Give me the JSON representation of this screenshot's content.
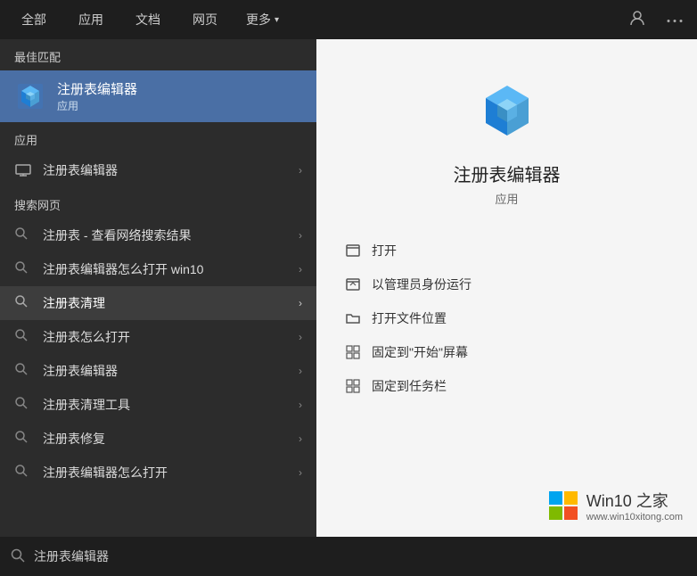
{
  "topBar": {
    "tabs": [
      {
        "label": "全部",
        "id": "all"
      },
      {
        "label": "应用",
        "id": "apps"
      },
      {
        "label": "文档",
        "id": "docs"
      },
      {
        "label": "网页",
        "id": "web"
      },
      {
        "label": "更多",
        "id": "more"
      }
    ],
    "icons": {
      "user": "👤",
      "dots": "···"
    }
  },
  "leftPanel": {
    "bestMatch": {
      "sectionLabel": "最佳匹配",
      "name": "注册表编辑器",
      "type": "应用"
    },
    "appSection": {
      "sectionLabel": "应用",
      "items": [
        {
          "text": "注册表编辑器",
          "hasArrow": true
        }
      ]
    },
    "webSection": {
      "sectionLabel": "搜索网页",
      "items": [
        {
          "text": "注册表 - 查看网络搜索结果",
          "hasArrow": true
        },
        {
          "text": "注册表编辑器怎么打开 win10",
          "hasArrow": true
        },
        {
          "text": "注册表清理",
          "hasArrow": true,
          "highlighted": true
        },
        {
          "text": "注册表怎么打开",
          "hasArrow": true
        },
        {
          "text": "注册表编辑器",
          "hasArrow": true
        },
        {
          "text": "注册表清理工具",
          "hasArrow": true
        },
        {
          "text": "注册表修复",
          "hasArrow": true
        },
        {
          "text": "注册表编辑器怎么打开",
          "hasArrow": true
        }
      ]
    }
  },
  "rightPanel": {
    "appName": "注册表编辑器",
    "appType": "应用",
    "actions": [
      {
        "icon": "open",
        "label": "打开"
      },
      {
        "icon": "admin",
        "label": "以管理员身份运行"
      },
      {
        "icon": "folder",
        "label": "打开文件位置"
      },
      {
        "icon": "pin-start",
        "label": "固定到\"开始\"屏幕"
      },
      {
        "icon": "pin-task",
        "label": "固定到任务栏"
      }
    ]
  },
  "bottomBar": {
    "searchPlaceholder": "注册表编辑器",
    "searchValue": "注册表编辑器"
  },
  "watermark": {
    "title": "Win10 之家",
    "url": "www.win10xitong.com"
  }
}
